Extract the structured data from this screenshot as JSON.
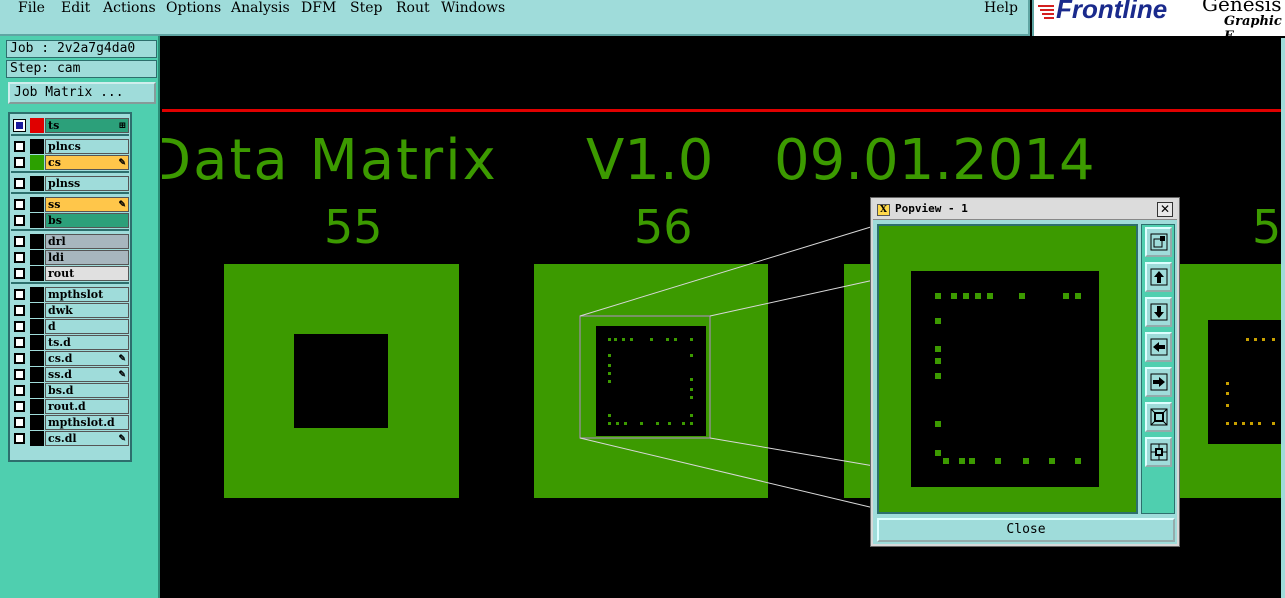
{
  "menubar": {
    "items": [
      "File",
      "Edit",
      "Actions",
      "Options",
      "Analysis",
      "DFM",
      "Step",
      "Rout",
      "Windows"
    ],
    "help": "Help"
  },
  "logo": {
    "brand": "Frontline",
    "product": "Genesis",
    "subtitle": "Graphic E"
  },
  "left_panel": {
    "job": "Job : 2v2a7g4da0",
    "step": "Step: cam",
    "job_matrix_button": "Job Matrix ..."
  },
  "layers": [
    {
      "name": "ts",
      "checked": true,
      "color": "#e00000",
      "bg": "#2ca07a",
      "flag": "⊞"
    },
    {
      "name": "plncs",
      "checked": false,
      "color": "#000000",
      "bg": "#9fdcda",
      "flag": ""
    },
    {
      "name": "cs",
      "checked": false,
      "color": "#2ca000",
      "bg": "#ffc64a",
      "flag": "✎"
    },
    {
      "name": "plnss",
      "checked": false,
      "color": "#000000",
      "bg": "#9fdcda",
      "flag": ""
    },
    {
      "name": "ss",
      "checked": false,
      "color": "#000000",
      "bg": "#ffc64a",
      "flag": "✎"
    },
    {
      "name": "bs",
      "checked": false,
      "color": "#000000",
      "bg": "#2ca07a",
      "flag": ""
    },
    {
      "name": "drl",
      "checked": false,
      "color": "#000000",
      "bg": "#a7b6be",
      "flag": ""
    },
    {
      "name": "ldi",
      "checked": false,
      "color": "#000000",
      "bg": "#a7b6be",
      "flag": ""
    },
    {
      "name": "rout",
      "checked": false,
      "color": "#000000",
      "bg": "#e0e0e0",
      "flag": ""
    },
    {
      "name": "mpthslot",
      "checked": false,
      "color": "#000000",
      "bg": "#9fdcda",
      "flag": ""
    },
    {
      "name": "dwk",
      "checked": false,
      "color": "#000000",
      "bg": "#9fdcda",
      "flag": ""
    },
    {
      "name": "d",
      "checked": false,
      "color": "#000000",
      "bg": "#9fdcda",
      "flag": ""
    },
    {
      "name": "ts.d",
      "checked": false,
      "color": "#000000",
      "bg": "#9fdcda",
      "flag": ""
    },
    {
      "name": "cs.d",
      "checked": false,
      "color": "#000000",
      "bg": "#9fdcda",
      "flag": "✎"
    },
    {
      "name": "ss.d",
      "checked": false,
      "color": "#000000",
      "bg": "#9fdcda",
      "flag": "✎"
    },
    {
      "name": "bs.d",
      "checked": false,
      "color": "#000000",
      "bg": "#9fdcda",
      "flag": ""
    },
    {
      "name": "rout.d",
      "checked": false,
      "color": "#000000",
      "bg": "#9fdcda",
      "flag": ""
    },
    {
      "name": "mpthslot.d",
      "checked": false,
      "color": "#000000",
      "bg": "#9fdcda",
      "flag": ""
    },
    {
      "name": "cs.dl",
      "checked": false,
      "color": "#000000",
      "bg": "#9fdcda",
      "flag": "✎"
    }
  ],
  "canvas": {
    "title_left": "Data Matrix",
    "version": "V1.0",
    "date": "09.01.2014",
    "label_55": "55",
    "label_56": "56",
    "label_57_partial": "5",
    "colors": {
      "copper": "#3c9a00",
      "highlight": "#c8a000",
      "background": "#000000"
    }
  },
  "popview": {
    "title": "Popview - 1",
    "close_label": "Close",
    "close_x": "✕",
    "tools": [
      "zoom-fit-icon",
      "pan-up-icon",
      "pan-down-icon",
      "pan-left-icon",
      "pan-right-icon",
      "zoom-in-icon",
      "zoom-out-icon"
    ]
  }
}
